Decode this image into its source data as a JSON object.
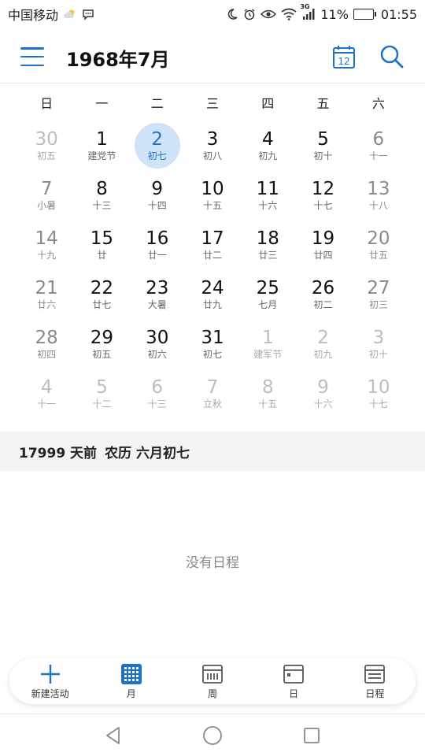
{
  "status_bar": {
    "carrier": "中国移动",
    "network": "3G",
    "battery_pct": "11%",
    "battery_level": 0.11,
    "time": "01:55"
  },
  "header": {
    "title": "1968年7月",
    "today_label": "12"
  },
  "weekdays": [
    "日",
    "一",
    "二",
    "三",
    "四",
    "五",
    "六"
  ],
  "days": [
    {
      "num": "30",
      "lunar": "初五",
      "type": "other"
    },
    {
      "num": "1",
      "lunar": "建党节",
      "type": "cur"
    },
    {
      "num": "2",
      "lunar": "初七",
      "type": "cur",
      "selected": true
    },
    {
      "num": "3",
      "lunar": "初八",
      "type": "cur"
    },
    {
      "num": "4",
      "lunar": "初九",
      "type": "cur"
    },
    {
      "num": "5",
      "lunar": "初十",
      "type": "cur"
    },
    {
      "num": "6",
      "lunar": "十一",
      "type": "weekend"
    },
    {
      "num": "7",
      "lunar": "小暑",
      "type": "weekend"
    },
    {
      "num": "8",
      "lunar": "十三",
      "type": "cur"
    },
    {
      "num": "9",
      "lunar": "十四",
      "type": "cur"
    },
    {
      "num": "10",
      "lunar": "十五",
      "type": "cur"
    },
    {
      "num": "11",
      "lunar": "十六",
      "type": "cur"
    },
    {
      "num": "12",
      "lunar": "十七",
      "type": "cur"
    },
    {
      "num": "13",
      "lunar": "十八",
      "type": "weekend"
    },
    {
      "num": "14",
      "lunar": "十九",
      "type": "weekend"
    },
    {
      "num": "15",
      "lunar": "廿",
      "type": "cur"
    },
    {
      "num": "16",
      "lunar": "廿一",
      "type": "cur"
    },
    {
      "num": "17",
      "lunar": "廿二",
      "type": "cur"
    },
    {
      "num": "18",
      "lunar": "廿三",
      "type": "cur"
    },
    {
      "num": "19",
      "lunar": "廿四",
      "type": "cur"
    },
    {
      "num": "20",
      "lunar": "廿五",
      "type": "weekend"
    },
    {
      "num": "21",
      "lunar": "廿六",
      "type": "weekend"
    },
    {
      "num": "22",
      "lunar": "廿七",
      "type": "cur"
    },
    {
      "num": "23",
      "lunar": "大暑",
      "type": "cur"
    },
    {
      "num": "24",
      "lunar": "廿九",
      "type": "cur"
    },
    {
      "num": "25",
      "lunar": "七月",
      "type": "cur"
    },
    {
      "num": "26",
      "lunar": "初二",
      "type": "cur"
    },
    {
      "num": "27",
      "lunar": "初三",
      "type": "weekend"
    },
    {
      "num": "28",
      "lunar": "初四",
      "type": "weekend"
    },
    {
      "num": "29",
      "lunar": "初五",
      "type": "cur"
    },
    {
      "num": "30",
      "lunar": "初六",
      "type": "cur"
    },
    {
      "num": "31",
      "lunar": "初七",
      "type": "cur"
    },
    {
      "num": "1",
      "lunar": "建军节",
      "type": "other"
    },
    {
      "num": "2",
      "lunar": "初九",
      "type": "other"
    },
    {
      "num": "3",
      "lunar": "初十",
      "type": "other"
    },
    {
      "num": "4",
      "lunar": "十一",
      "type": "other"
    },
    {
      "num": "5",
      "lunar": "十二",
      "type": "other"
    },
    {
      "num": "6",
      "lunar": "十三",
      "type": "other"
    },
    {
      "num": "7",
      "lunar": "立秋",
      "type": "other"
    },
    {
      "num": "8",
      "lunar": "十五",
      "type": "other"
    },
    {
      "num": "9",
      "lunar": "十六",
      "type": "other"
    },
    {
      "num": "10",
      "lunar": "十七",
      "type": "other"
    }
  ],
  "info": {
    "days_ago": "17999 天前",
    "lunar_date": "农历 六月初七"
  },
  "empty_text": "没有日程",
  "bottom_nav": [
    {
      "label": "新建活动",
      "icon": "plus-icon",
      "active": false
    },
    {
      "label": "月",
      "icon": "month-grid-icon",
      "active": true
    },
    {
      "label": "周",
      "icon": "week-icon",
      "active": false
    },
    {
      "label": "日",
      "icon": "day-icon",
      "active": false
    },
    {
      "label": "日程",
      "icon": "agenda-icon",
      "active": false
    }
  ],
  "colors": {
    "accent": "#1a73c8",
    "selected_bg": "#cfe3f8",
    "muted": "#8a8a8a",
    "other_month": "#bdbdbd",
    "battery_fill": "#f2b200"
  }
}
